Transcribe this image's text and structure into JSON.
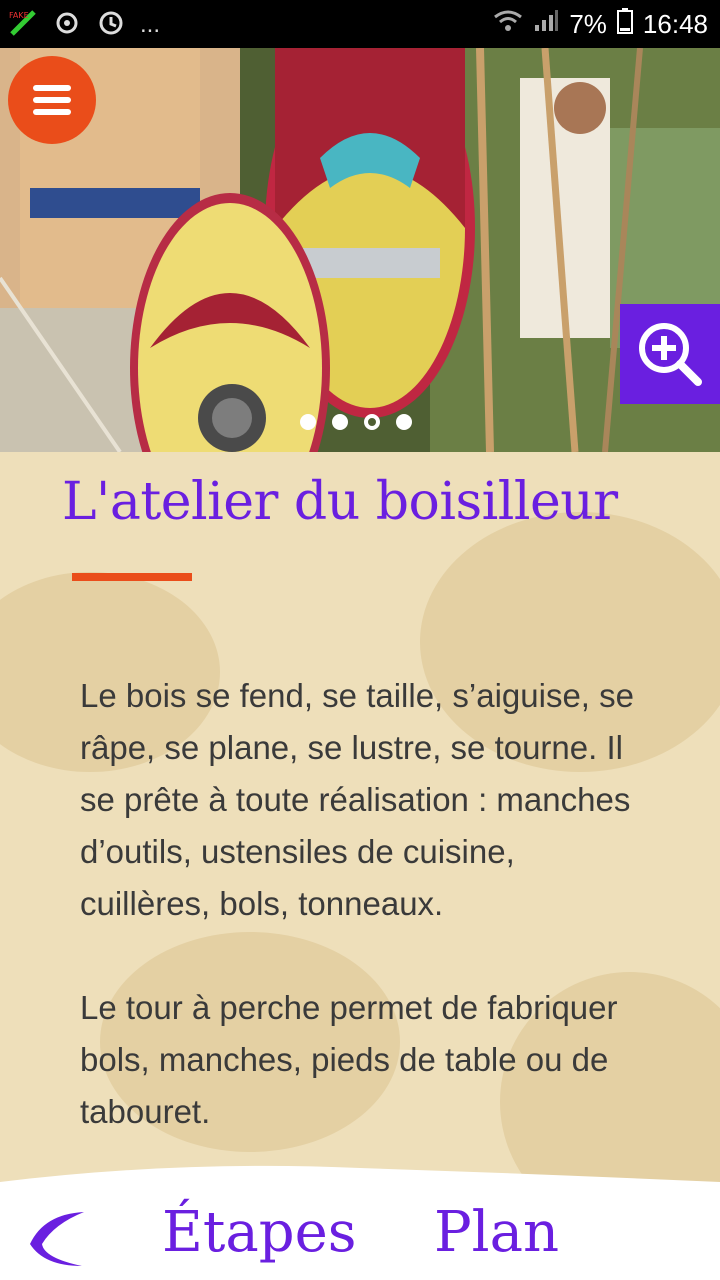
{
  "status_bar": {
    "left_icons": [
      "fake-gps-icon",
      "cloud-sync-icon",
      "refresh-icon"
    ],
    "overflow": "...",
    "battery": "7%",
    "time": "16:48"
  },
  "hero": {
    "slide_count": 4,
    "active_slide": 3
  },
  "article": {
    "title": "L'atelier du boisilleur",
    "paragraphs": [
      "Le bois se fend, se taille, s’aiguise, se râpe, se plane, se lustre, se tourne. Il se prête à toute réalisation : manches d’outils, ustensiles de cuisine, cuillères, bols, tonneaux.",
      "Le tour à perche permet de fabriquer bols, manches, pieds de table ou de tabouret."
    ]
  },
  "bottom_nav": {
    "back_icon": "back-swoosh-icon",
    "etapes_label": "Étapes",
    "plan_label": "Plan"
  },
  "colors": {
    "accent_purple": "#6a1fe0",
    "accent_orange": "#ea4d1a",
    "parchment": "#eedfba"
  }
}
